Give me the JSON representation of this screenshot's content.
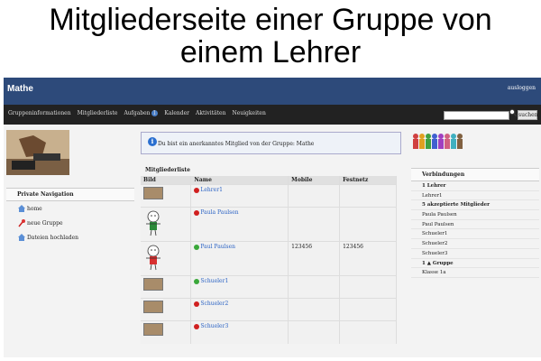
{
  "caption": {
    "line1": "Mitgliederseite einer Gruppe von",
    "line2": "einem Lehrer"
  },
  "header": {
    "title": "Mathe",
    "logout": "ausloggen"
  },
  "nav": {
    "items": [
      "Gruppeninformationen",
      "Mitgliederliste",
      "Aufgaben",
      "Kalender",
      "Aktivitäten",
      "Neuigkeiten"
    ],
    "badge": "1"
  },
  "search": {
    "value": "",
    "button": "suchen"
  },
  "left": {
    "title": "Private Navigation",
    "items": [
      "home",
      "neue Gruppe",
      "Dateien hochladen"
    ]
  },
  "info": {
    "text": "Du bist ein anerkanntes Mitglied von der Gruppe: Mathe"
  },
  "members": {
    "title": "Mitgliederliste",
    "columns": [
      "Bild",
      "Name",
      "Mobile",
      "Festnetz"
    ],
    "rows": [
      {
        "name": "Lehrer1",
        "status": "red",
        "mobile": "",
        "festnetz": ""
      },
      {
        "name": "Paula Paulsen",
        "status": "red",
        "mobile": "",
        "festnetz": ""
      },
      {
        "name": "Paul Paulsen",
        "status": "green",
        "mobile": "123456",
        "festnetz": "123456"
      },
      {
        "name": "Schueler1",
        "status": "green",
        "mobile": "",
        "festnetz": ""
      },
      {
        "name": "Schueler2",
        "status": "red",
        "mobile": "",
        "festnetz": ""
      },
      {
        "name": "Schueler3",
        "status": "red",
        "mobile": "",
        "festnetz": ""
      }
    ]
  },
  "right": {
    "title": "Verbindungen",
    "items": [
      {
        "text": "1 Lehrer",
        "bold": true
      },
      {
        "text": "Lehrer1",
        "bold": false
      },
      {
        "text": "5 akzeptierte Mitglieder",
        "bold": true
      },
      {
        "text": "Paula Paulsen",
        "bold": false
      },
      {
        "text": "Paul Paulsen",
        "bold": false
      },
      {
        "text": "Schueler1",
        "bold": false
      },
      {
        "text": "Schueler2",
        "bold": false
      },
      {
        "text": "Schueler3",
        "bold": false
      },
      {
        "text": "1 ▲ Gruppe",
        "bold": true
      },
      {
        "text": "Klasse 1a",
        "bold": false
      }
    ]
  },
  "colors": {
    "header": "#2d4a7a",
    "navbar": "#222222",
    "link": "#2a62c4",
    "online": "#3aa83a",
    "offline": "#d02020"
  }
}
